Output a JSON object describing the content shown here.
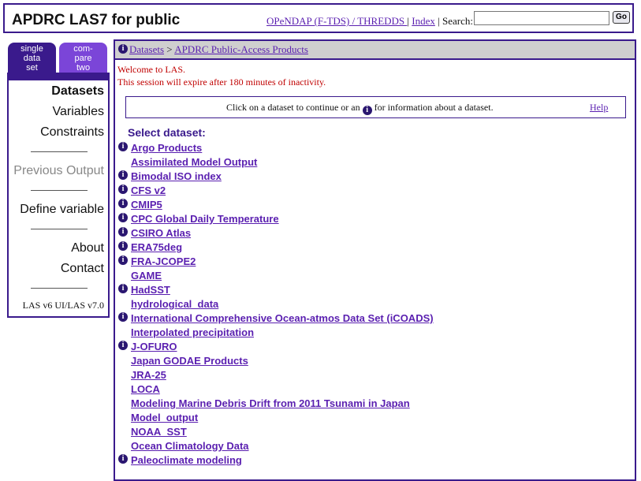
{
  "header": {
    "title": "APDRC LAS7 for public",
    "opendap_link": "OPeNDAP (F-TDS) / THREDDS ",
    "separator": "|",
    "index_link": "Index",
    "search_label": "| Search:",
    "search_value": "",
    "go_label": "Go"
  },
  "tabs": {
    "single": [
      "single",
      "data",
      "set"
    ],
    "compare": [
      "com-",
      "pare",
      "two"
    ]
  },
  "nav": {
    "datasets": "Datasets",
    "variables": "Variables",
    "constraints": "Constraints",
    "previous_output": "Previous Output",
    "define_variable": "Define variable",
    "about": "About",
    "contact": "Contact",
    "version": "LAS v6 UI/LAS v7.0"
  },
  "breadcrumb": {
    "datasets": "Datasets",
    "sep": ">",
    "current": "APDRC Public-Access Products"
  },
  "messages": {
    "welcome": "Welcome to LAS.",
    "expire": "This session will expire after 180 minutes of inactivity."
  },
  "help_box": {
    "text_before": "Click on a dataset to continue or an",
    "text_after": "for information about a dataset.",
    "help_link": "Help"
  },
  "select_header": "Select dataset:",
  "datasets": [
    {
      "name": "Argo Products",
      "info": true
    },
    {
      "name": "Assimilated Model Output",
      "info": false
    },
    {
      "name": "Bimodal ISO index",
      "info": true
    },
    {
      "name": "CFS v2",
      "info": true
    },
    {
      "name": "CMIP5",
      "info": true
    },
    {
      "name": "CPC Global Daily Temperature",
      "info": true
    },
    {
      "name": "CSIRO Atlas",
      "info": true
    },
    {
      "name": "ERA75deg",
      "info": true
    },
    {
      "name": "FRA-JCOPE2",
      "info": true
    },
    {
      "name": "GAME",
      "info": false
    },
    {
      "name": "HadSST",
      "info": true
    },
    {
      "name": "hydrological_data",
      "info": false
    },
    {
      "name": "International Comprehensive Ocean-atmos Data Set (iCOADS)",
      "info": true
    },
    {
      "name": "Interpolated precipitation",
      "info": false
    },
    {
      "name": "J-OFURO",
      "info": true
    },
    {
      "name": "Japan GODAE Products",
      "info": false
    },
    {
      "name": "JRA-25",
      "info": false
    },
    {
      "name": "LOCA",
      "info": false
    },
    {
      "name": "Modeling Marine Debris Drift from 2011 Tsunami in Japan",
      "info": false
    },
    {
      "name": "Model_output",
      "info": false
    },
    {
      "name": "NOAA_SST",
      "info": false
    },
    {
      "name": "Ocean Climatology Data",
      "info": false
    },
    {
      "name": "Paleoclimate modeling",
      "info": true
    }
  ],
  "icons": {
    "info": "info-icon"
  },
  "colors": {
    "accent": "#3a1a8c",
    "tab_inactive": "#7b45d8",
    "link": "#5a1fb0",
    "warning": "#c00000",
    "crumb_bg": "#cfcfcf"
  }
}
